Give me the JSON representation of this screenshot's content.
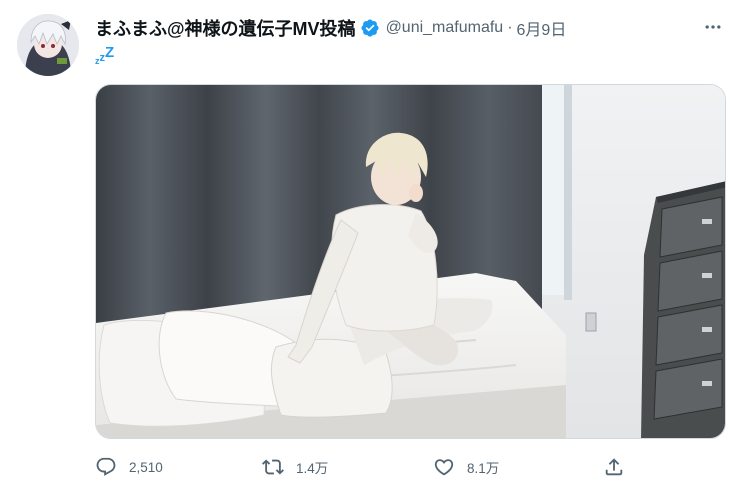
{
  "tweet": {
    "display_name": "まふまふ@神様の遺伝子MV投稿",
    "handle": "@uni_mafumafu",
    "separator": "·",
    "date": "6月9日",
    "body": [
      "z",
      "z",
      "Z"
    ],
    "stats": {
      "replies": "2,510",
      "retweets": "1.4万",
      "likes": "8.1万"
    }
  },
  "colors": {
    "accent": "#1d9bf0",
    "muted": "#536471",
    "text": "#0f1419",
    "border": "#cfd9de"
  },
  "icons": {
    "verified": "verified-badge-icon",
    "more": "more-options-icon",
    "reply": "reply-icon",
    "retweet": "retweet-icon",
    "like": "heart-icon",
    "share": "share-icon"
  }
}
